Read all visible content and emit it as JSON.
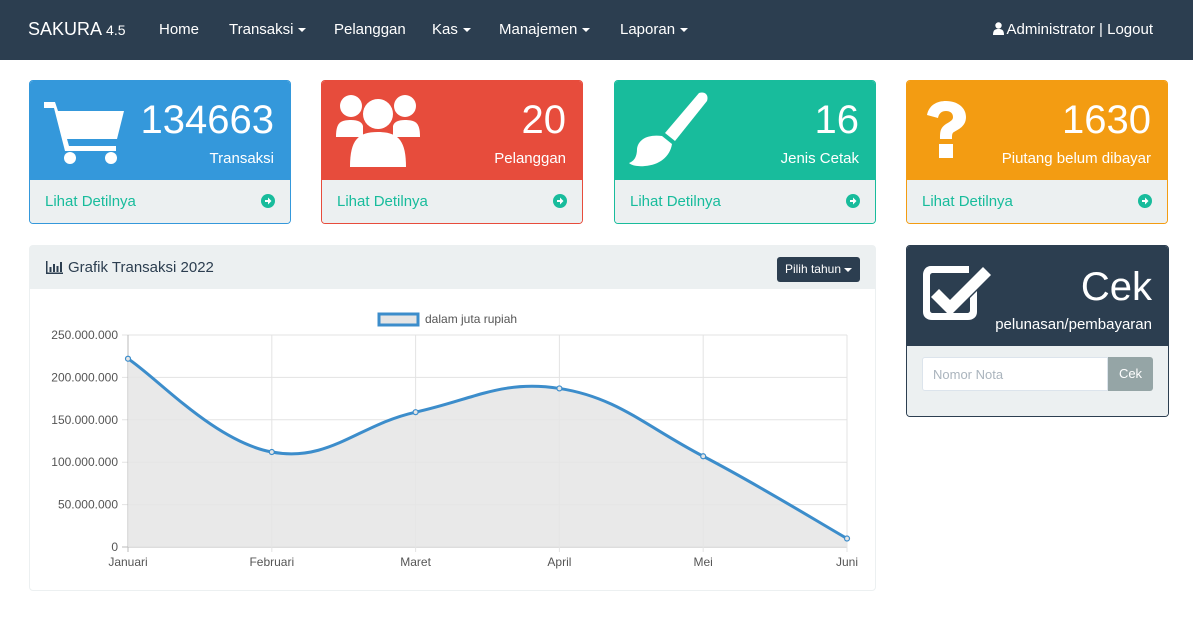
{
  "navbar": {
    "brand": "SAKURA",
    "version": "4.5",
    "items": [
      {
        "label": "Home",
        "dropdown": false
      },
      {
        "label": "Transaksi",
        "dropdown": true
      },
      {
        "label": "Pelanggan",
        "dropdown": false
      },
      {
        "label": "Kas",
        "dropdown": true
      },
      {
        "label": "Manajemen",
        "dropdown": true
      },
      {
        "label": "Laporan",
        "dropdown": true
      }
    ],
    "user": "Administrator",
    "separator": "|",
    "logout": "Logout"
  },
  "cards": [
    {
      "value": "134663",
      "label": "Transaksi",
      "link": "Lihat Detilnya",
      "icon": "shopping-cart-icon",
      "color": "#3498db"
    },
    {
      "value": "20",
      "label": "Pelanggan",
      "link": "Lihat Detilnya",
      "icon": "users-icon",
      "color": "#e74c3c"
    },
    {
      "value": "16",
      "label": "Jenis Cetak",
      "link": "Lihat Detilnya",
      "icon": "paint-brush-icon",
      "color": "#18bc9c"
    },
    {
      "value": "1630",
      "label": "Piutang belum dibayar",
      "link": "Lihat Detilnya",
      "icon": "question-icon",
      "color": "#f39c12"
    }
  ],
  "chart_panel": {
    "title": "Grafik Transaksi 2022",
    "button": "Pilih tahun",
    "icon": "bar-chart-icon"
  },
  "chart_data": {
    "type": "line",
    "categories": [
      "Januari",
      "Februari",
      "Maret",
      "April",
      "Mei",
      "Juni"
    ],
    "series": [
      {
        "name": "dalam juta rupiah",
        "values": [
          222000000,
          112000000,
          159000000,
          187000000,
          107000000,
          10000000
        ],
        "color": "#3c8dcb",
        "fill": "#e5e5e5"
      }
    ],
    "y_ticks": [
      "0",
      "50.000.000",
      "100.000.000",
      "150.000.000",
      "200.000.000",
      "250.000.000"
    ],
    "ylim": [
      0,
      250000000
    ],
    "grid": true,
    "legend": "top-center"
  },
  "cek_panel": {
    "title": "Cek",
    "subtitle": "pelunasan/pembayaran",
    "input_placeholder": "Nomor Nota",
    "button": "Cek",
    "icon": "check-square-icon"
  }
}
